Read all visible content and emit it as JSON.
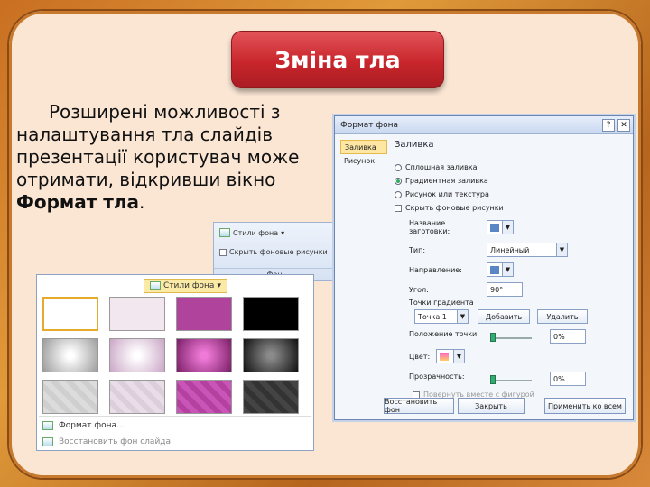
{
  "slide": {
    "title": "Зміна тла",
    "body_text": "Розширені можливості з налаштування тла слайдів презентації користувач може отримати, відкривши вікно ",
    "body_bold": "Формат тла",
    "body_end": "."
  },
  "ribbon": {
    "styles_label": "Стили фона",
    "hide_label": "Скрыть фоновые рисунки",
    "group_label": "Фон"
  },
  "gallery": {
    "header": "Стили фона",
    "format_link": "Формат фона...",
    "restore_link": "Восстановить фон слайда",
    "swatches": [
      "#ffffff",
      "#f2e6ef",
      "#b0449c",
      "#000000",
      "radial-gradient(circle, #ffffff 10%, #9c9c9c 100%)",
      "radial-gradient(circle, #ffffff 10%, #caa6c6 100%)",
      "radial-gradient(circle, #f07ad8 10%, #7a1f66 100%)",
      "radial-gradient(circle, #8a8a8a 10%, #111111 100%)",
      "repeating-linear-gradient(45deg, #dcdcdc 0 6px, #cfcfcf 6px 12px)",
      "repeating-linear-gradient(45deg, #e9dde8 0 6px, #dccfdb 6px 12px)",
      "repeating-linear-gradient(45deg, #c955b8 0 6px, #b4409f 6px 12px)",
      "repeating-linear-gradient(45deg, #444444 0 6px, #333333 6px 12px)"
    ]
  },
  "dialog": {
    "title": "Формат фона",
    "help_button": "?",
    "close_button": "✕",
    "side_items": [
      "Заливка",
      "Рисунок"
    ],
    "section_title": "Заливка",
    "fill_options": [
      "Сплошная заливка",
      "Градиентная заливка",
      "Рисунок или текстура",
      "Скрыть фоновые рисунки"
    ],
    "preset_label": "Название заготовки:",
    "type_label": "Тип:",
    "type_value": "Линейный",
    "direction_label": "Направление:",
    "angle_label": "Угол:",
    "angle_value": "90°",
    "stops_label": "Точки градиента",
    "stop_value": "Точка 1",
    "add_button": "Добавить",
    "delete_button": "Удалить",
    "position_label": "Положение точки:",
    "position_value": "0%",
    "color_label": "Цвет:",
    "transparency_label": "Прозрачность:",
    "transparency_value": "0%",
    "rotate_label": "Повернуть вместе с фигурой",
    "restore_button": "Восстановить фон",
    "close_footer_button": "Закрыть",
    "apply_all_button": "Применить ко всем"
  },
  "colors": {
    "title_red": "#c8262c",
    "slide_bg": "#fbe6d4",
    "frame_orange": "#c96f22"
  }
}
